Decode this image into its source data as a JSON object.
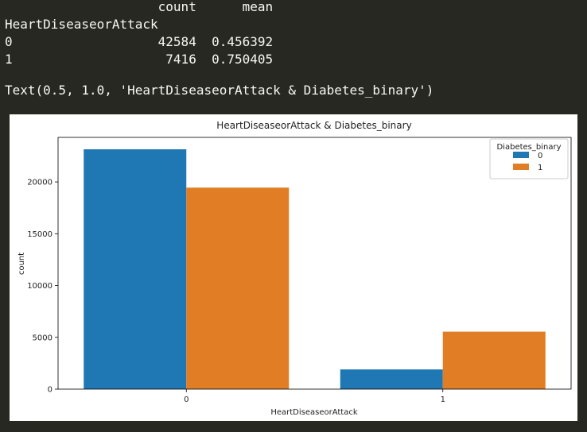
{
  "output": {
    "table_header": "                    count      mean",
    "table_index_name": "HeartDiseaseorAttack",
    "table_rows": [
      "0                   42584  0.456392",
      "1                    7416  0.750405"
    ],
    "text_repr": "Text(0.5, 1.0, 'HeartDiseaseorAttack & Diabetes_binary')"
  },
  "chart_data": {
    "type": "bar",
    "title": "HeartDiseaseorAttack & Diabetes_binary",
    "xlabel": "HeartDiseaseorAttack",
    "ylabel": "count",
    "categories": [
      "0",
      "1"
    ],
    "series": [
      {
        "name": "0",
        "values": [
          23150,
          1900
        ],
        "color": "#1f77b4"
      },
      {
        "name": "1",
        "values": [
          19450,
          5550
        ],
        "color": "#e07d25"
      }
    ],
    "ylim": [
      0,
      24300
    ],
    "yticks": [
      0,
      5000,
      10000,
      15000,
      20000
    ],
    "legend": {
      "title": "Diabetes_binary",
      "location": "top-right"
    },
    "grid": false
  }
}
